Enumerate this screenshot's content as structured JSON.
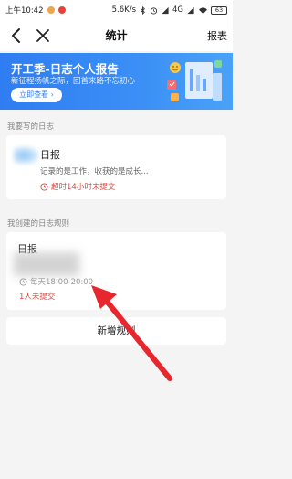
{
  "status_bar": {
    "time": "上午10:42",
    "network_speed": "5.6K/s",
    "network_type": "4G",
    "battery": "63"
  },
  "nav": {
    "title": "统计",
    "report_label": "报表"
  },
  "banner": {
    "title": "开工季-日志个人报告",
    "subtitle": "新征程扬帆之际，回首来路不忘初心",
    "button_label": "立即查看 ›"
  },
  "section_written": {
    "label": "我要写的日志",
    "card": {
      "title": "日报",
      "description": "记录的是工作，收获的是成长...",
      "warning": "超时14小时未提交"
    }
  },
  "section_rules": {
    "label": "我创建的日志规则",
    "card": {
      "title": "日报",
      "time": "每天18:00-20:00",
      "pending": "1人未提交"
    },
    "add_rule_label": "新增规则"
  },
  "colors": {
    "accent": "#2f7df2",
    "warning": "#e2433a",
    "annotation_arrow": "#e8262d"
  }
}
